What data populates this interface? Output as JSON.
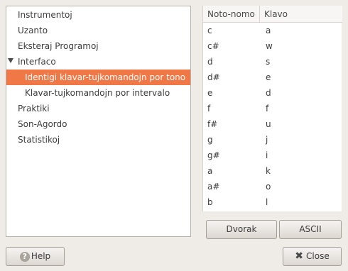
{
  "tree": {
    "items": [
      {
        "label": "Instrumentoj"
      },
      {
        "label": "Uzanto"
      },
      {
        "label": "Eksteraj Programoj"
      },
      {
        "label": "Interfaco"
      },
      {
        "label": "Identigi klavar-tujkomandojn por tono"
      },
      {
        "label": "Klavar-tujkomandojn por intervalo"
      },
      {
        "label": "Praktiki"
      },
      {
        "label": "Son-Agordo"
      },
      {
        "label": "Statistikoj"
      }
    ],
    "selected_label": "Identigi klavar-tujkomandojn por tono"
  },
  "table": {
    "headers": {
      "note": "Noto-nomo",
      "key": "Klavo"
    },
    "rows": [
      {
        "note": "c",
        "key": "a"
      },
      {
        "note": "c#",
        "key": "w"
      },
      {
        "note": "d",
        "key": "s"
      },
      {
        "note": "d#",
        "key": "e"
      },
      {
        "note": "e",
        "key": "d"
      },
      {
        "note": "f",
        "key": "f"
      },
      {
        "note": "f#",
        "key": "u"
      },
      {
        "note": "g",
        "key": "j"
      },
      {
        "note": "g#",
        "key": "i"
      },
      {
        "note": "a",
        "key": "k"
      },
      {
        "note": "a#",
        "key": "o"
      },
      {
        "note": "b",
        "key": "l"
      }
    ]
  },
  "buttons": {
    "dvorak": "Dvorak",
    "ascii": "ASCII",
    "help": "Help",
    "close": "Close"
  },
  "colors": {
    "selection": "#f07746",
    "background": "#efebe7"
  },
  "icons": {
    "expander": "triangle-down",
    "help": "question-circle",
    "close": "x-mark"
  }
}
